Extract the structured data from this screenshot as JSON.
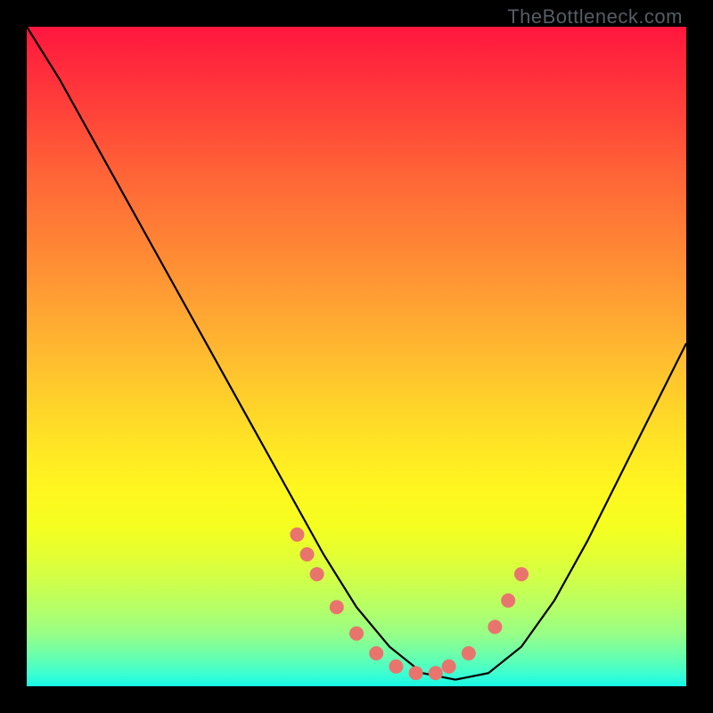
{
  "watermark": "TheBottleneck.com",
  "colors": {
    "background": "#000000",
    "curve_stroke": "#000000",
    "dot_fill": "#E9746E",
    "gradient_top": "#FF163E",
    "gradient_bottom": "#17F8E6"
  },
  "chart_data": {
    "type": "line",
    "title": "",
    "xlabel": "",
    "ylabel": "",
    "xlim": [
      0,
      100
    ],
    "ylim": [
      0,
      100
    ],
    "x": [
      0,
      5,
      10,
      15,
      20,
      25,
      30,
      35,
      40,
      45,
      50,
      55,
      60,
      65,
      70,
      75,
      80,
      85,
      90,
      95,
      100
    ],
    "y": [
      100,
      92,
      83,
      74,
      65,
      56,
      47,
      38,
      29,
      20,
      12,
      6,
      2,
      1,
      2,
      6,
      13,
      22,
      32,
      42,
      52
    ],
    "highlight_points": {
      "x": [
        41,
        42.5,
        44,
        47,
        50,
        53,
        56,
        59,
        62,
        64,
        67,
        71,
        73,
        75
      ],
      "y": [
        23,
        20,
        17,
        12,
        8,
        5,
        3,
        2,
        2,
        3,
        5,
        9,
        13,
        17
      ]
    },
    "legend": []
  }
}
